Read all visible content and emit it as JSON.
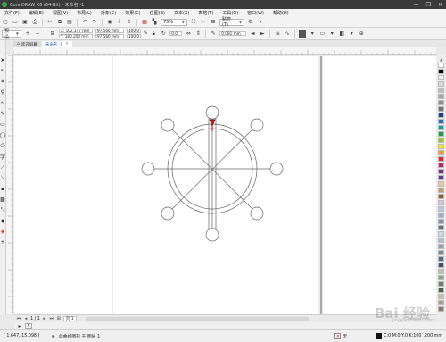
{
  "window": {
    "title": "CorelDRAW X8 (64-Bit) - 未命名 -1",
    "controls": [
      "—",
      "❐",
      "✕"
    ]
  },
  "menu": [
    "文件(F)",
    "编辑(E)",
    "视图(V)",
    "布局(L)",
    "对象(C)",
    "效果(C)",
    "位图(B)",
    "文本(X)",
    "表格(T)",
    "工具(O)",
    "窗口(W)",
    "帮助(H)"
  ],
  "toolbar": {
    "zoom": "75%",
    "snap_label": "贴齐(T)"
  },
  "properties": {
    "preset": "预设...",
    "x": "X: 102.147 mm",
    "y": "Y: 180.200 mm",
    "width": "97.566 mm",
    "height": "97.566 mm",
    "scale_w": "100.0",
    "scale_h": "100.0",
    "percent": "%",
    "rotation": "0.0",
    "outline_width": "0.081 mm",
    "copies": "1",
    "fill_label": "无"
  },
  "document_tabs": [
    "欢迎屏幕",
    "未命名 -1"
  ],
  "page_nav": {
    "page_label": "页 1",
    "counter": "1 / 1"
  },
  "status": {
    "coords": "( 1.647, 15.098 )",
    "object_info": "此曲线图形 于 图层 1",
    "fill": "无",
    "cmyk": "C:0 M:0 Y:0 K:100",
    "outline": ".200 mm"
  },
  "watermark": {
    "text": "Bai 经验",
    "sub": "jingyan.baidu.com"
  },
  "palette_colors": [
    "#ffffff",
    "#000000",
    "#f2f2f2",
    "#d9d9d9",
    "#bfbfbf",
    "#a6a6a6",
    "#8c8c8c",
    "#737373",
    "#1d3b8a",
    "#2b6cc4",
    "#0aa3a3",
    "#1aa04a",
    "#9dc91e",
    "#ffe600",
    "#f7941d",
    "#e8232c",
    "#c81f6c",
    "#7b2a86",
    "#5c3b8f",
    "#f4c39a",
    "#c79a6b",
    "#8b5a2b",
    "#e6c3d9",
    "#b9c6e6",
    "#9ab0c8",
    "#7f8fa8",
    "#5c6b80",
    "#c9dbe8",
    "#adbfcc",
    "#8da0b0",
    "#7088a0",
    "#556b84",
    "#3f5266",
    "#b5c2b0",
    "#90a08a",
    "#6f7f6b",
    "#52604f",
    "#c9c0a9",
    "#a89e86",
    "#857b66"
  ],
  "colors": {
    "accent": "#1a5fb4",
    "ship_wheel_red": "#d21f1f"
  }
}
